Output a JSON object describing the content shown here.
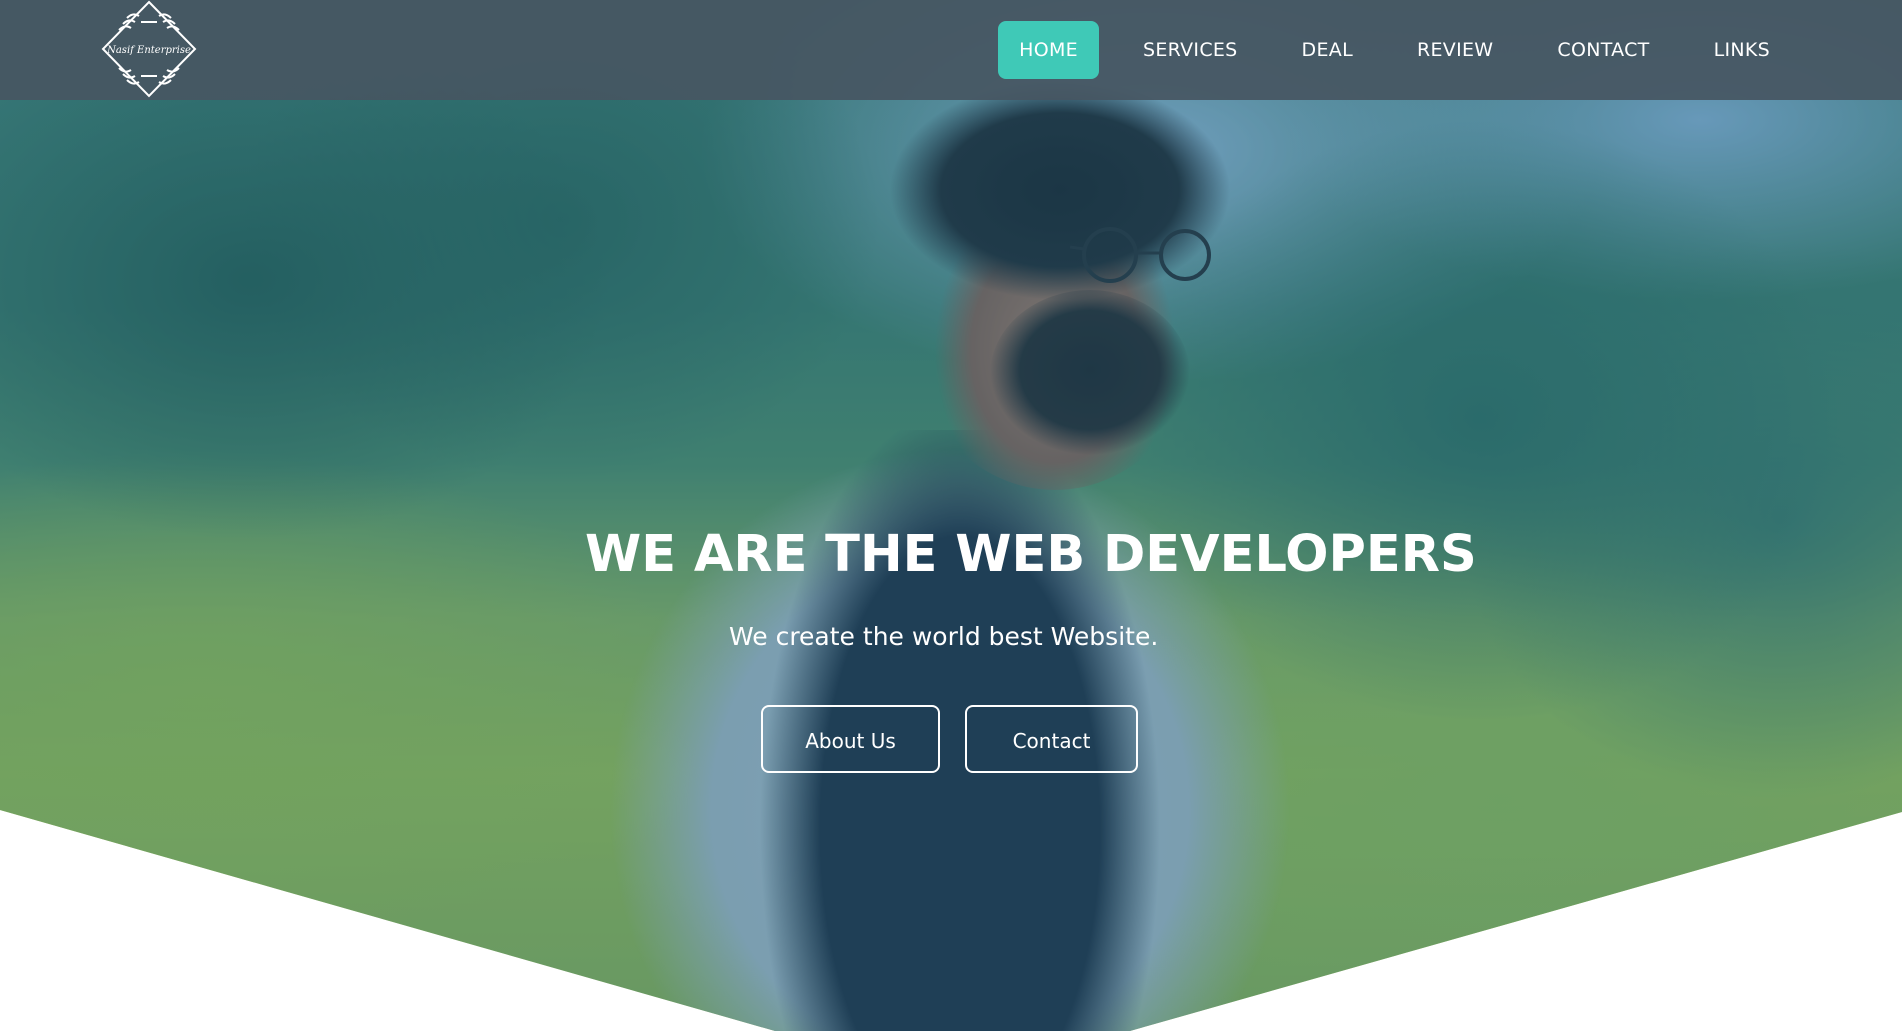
{
  "brand": {
    "logo_text": "Nasif Enterprise",
    "accent_color": "#3fc9b7",
    "nav_bg": "#465662"
  },
  "nav": {
    "items": [
      {
        "label": "HOME",
        "active": true
      },
      {
        "label": "SERVICES",
        "active": false
      },
      {
        "label": "DEAL",
        "active": false
      },
      {
        "label": "REVIEW",
        "active": false
      },
      {
        "label": "CONTACT",
        "active": false
      },
      {
        "label": "LINKS",
        "active": false
      }
    ]
  },
  "hero": {
    "title": "WE ARE THE WEB DEVELOPERS",
    "subtitle": "We create the world best Website.",
    "buttons": {
      "about": "About Us",
      "contact": "Contact"
    }
  }
}
